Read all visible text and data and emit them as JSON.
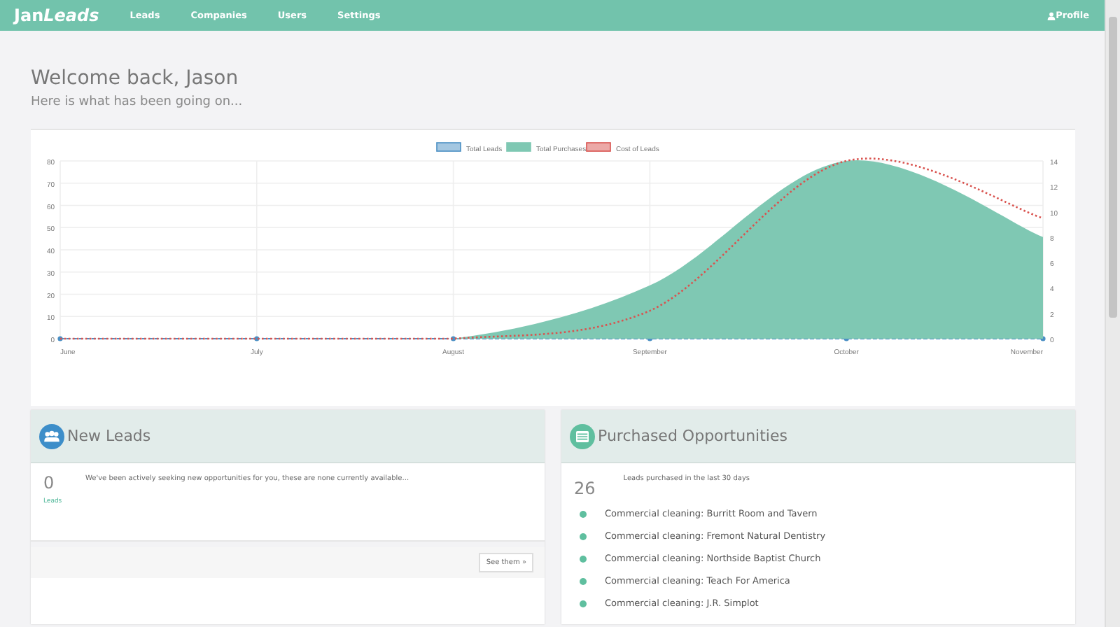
{
  "navbar": {
    "brand_plain": "Jan",
    "brand_italic": "Leads",
    "links": [
      {
        "label": "Leads",
        "selected": false
      },
      {
        "label": "Companies",
        "selected": false
      },
      {
        "label": "Users",
        "selected": false
      },
      {
        "label": "Settings",
        "selected": false
      }
    ],
    "profile": "Profile"
  },
  "welcome": {
    "title": "Welcome back, Jason",
    "subtitle": "Here is what has been going on..."
  },
  "chart": {
    "chart_data": {
      "type": "area",
      "grid": true,
      "legend": true,
      "categories": [
        "June",
        "July",
        "August",
        "September",
        "October",
        "November"
      ],
      "ylim": [
        0,
        80
      ],
      "yticks": [
        0,
        10,
        20,
        30,
        40,
        50,
        60,
        70,
        80
      ],
      "y2lim": [
        0,
        14
      ],
      "y2ticks": [
        0,
        2,
        4,
        6,
        8,
        10,
        12,
        14
      ],
      "series": [
        {
          "name": "Total Leads",
          "color": "#4a8fc4",
          "type": "line",
          "line_style": "dashed",
          "marker": "circle",
          "values": [
            0,
            0,
            0,
            0,
            0,
            0
          ]
        },
        {
          "name": "Total Purchases",
          "color": "#7fc8b3",
          "axis": "y2",
          "values": [
            0,
            0,
            0,
            4.2,
            14,
            8
          ]
        },
        {
          "name": "Cost of Leads",
          "color": "#d9534f",
          "axis": "y2",
          "type": "line",
          "line_style": "dotted",
          "values": [
            0,
            0,
            0,
            2.2,
            14,
            9.5
          ]
        }
      ]
    }
  },
  "new_leads": {
    "title": "New Leads",
    "count": "0",
    "count_label": "Leads",
    "message": "We've been actively seeking new opportunities for you, these are none currently available...",
    "button": "See them »"
  },
  "purchased": {
    "title": "Purchased Opportunities",
    "count": "26",
    "count_label": "Leads purchased in the last 30 days",
    "items": [
      "Commercial cleaning: Burritt Room and Tavern",
      "Commercial cleaning: Fremont Natural Dentistry",
      "Commercial cleaning: Northside Baptist Church",
      "Commercial cleaning: Teach For America",
      "Commercial cleaning: J.R. Simplot"
    ]
  }
}
